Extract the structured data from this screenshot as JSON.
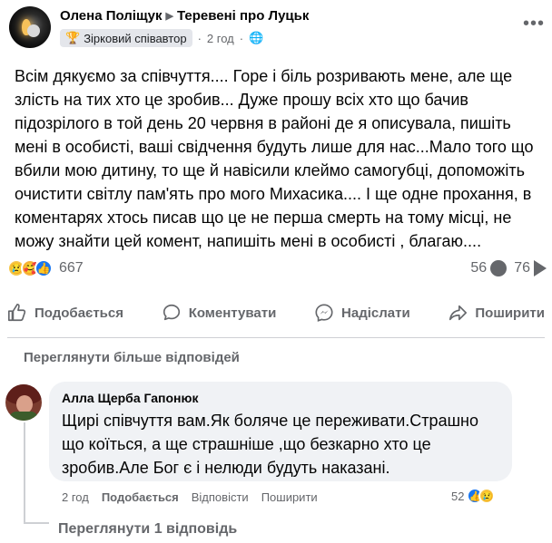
{
  "post": {
    "author": "Олена Поліщук",
    "group": "Теревені про Луцьк",
    "badge": "Зірковий співавтор",
    "time": "2 год",
    "separator": "·",
    "body": "Всім дякуємо за співчуття.... Горе і біль розривають мене, але ще злість на тих хто це зробив... Дуже прошу всіх хто що бачив підозрілого в той день 20 червня в районі де я описувала, пишіть мені в особисті,  ваші свідчення будуть  лише для нас...Мало того що вбили мою дитину, то ще й навісили клеймо самогубці, допоможіть очистити світлу пам'ять про мого Михасика.... І ще одне прохання, в коментарях хтось писав що це не перша смерть на тому місці, не можу знайти цей комент, напишіть мені в особисті , благаю...."
  },
  "stats": {
    "reactions_count": "667",
    "comments_count": "56",
    "shares_count": "76"
  },
  "actions": {
    "like": "Подобається",
    "comment": "Коментувати",
    "send": "Надіслати",
    "share": "Поширити"
  },
  "comments_section": {
    "view_more": "Переглянути більше відповідей",
    "view_reply": "Переглянути 1 відповідь"
  },
  "comment": {
    "author": "Алла Щерба Гапонюк",
    "text": "Щирі співчуття вам.Як боляче це переживати.Страшно що коїться, а ще страшніше ,що безкарно хто це зробив.Але Бог є і нелюди будуть наказані.",
    "time": "2 год",
    "like": "Подобається",
    "reply": "Відповісти",
    "share": "Поширити",
    "reactions_count": "52"
  },
  "colors": {
    "like_blue": "#1877f2",
    "secondary_text": "#65676b",
    "bubble_bg": "#f0f2f5"
  }
}
